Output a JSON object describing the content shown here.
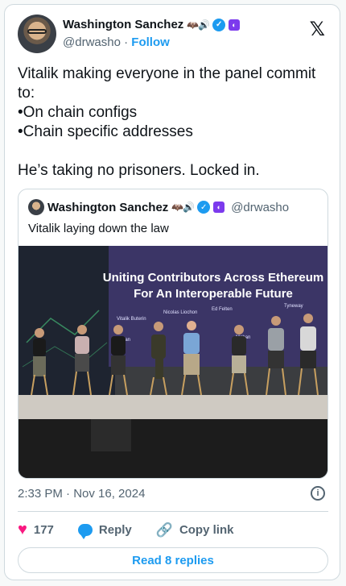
{
  "author": {
    "name": "Washington Sanchez",
    "badges": "🦇🔊",
    "handle": "@drwasho",
    "separator": "·",
    "follow_label": "Follow"
  },
  "tweet": {
    "text": "Vitalik making everyone in the panel commit to:\n•On chain configs\n•Chain specific addresses\n\nHe’s taking no prisoners. Locked in."
  },
  "quote": {
    "name": "Washington Sanchez",
    "badges": "🦇🔊",
    "handle": "@drwasho",
    "text": "Vitalik laying down the law",
    "photo": {
      "banner_line1": "Uniting Contributors Across Ethereum",
      "banner_line2": "For An Interoperable Future",
      "name_tags": [
        "Vitalik Buterin",
        "Nicolas Liochon",
        "Ed Felten",
        "Tyneway",
        "Mohan",
        "Brian"
      ]
    }
  },
  "meta": {
    "time": "2:33 PM · Nov 16, 2024"
  },
  "actions": {
    "likes": "177",
    "reply_label": "Reply",
    "copy_label": "Copy link"
  },
  "read_replies_label": "Read 8 replies"
}
